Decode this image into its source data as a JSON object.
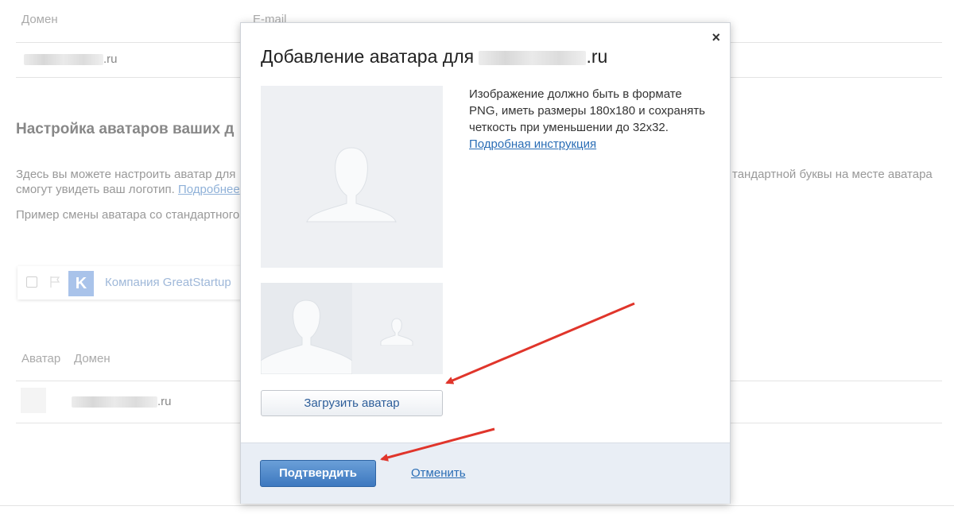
{
  "background": {
    "table1_header_domain": "Домен",
    "table1_header_email": "E-mail",
    "table1_row_domain_suffix": ".ru",
    "section_title": "Настройка аватаров ваших д",
    "description_left": "Здесь вы можете настроить аватар для",
    "description_left_2": "смогут увидеть ваш логотип.",
    "description_link": "Подробнее",
    "description_right": "тандартной буквы на месте аватара",
    "example_text": "Пример смены аватара со стандартного",
    "example_letter": "K",
    "example_company": "Компания GreatStartup",
    "table2_header_avatar": "Аватар",
    "table2_header_domain": "Домен",
    "table2_row_domain_suffix": ".ru"
  },
  "modal": {
    "title_prefix": "Добавление аватара для",
    "title_suffix": ".ru",
    "close_glyph": "×",
    "info_text": "Изображение должно быть в формате PNG, иметь размеры 180x180 и сохранять четкость при уменьшении до 32x32.",
    "info_link": "Подробная инструкция",
    "upload_label": "Загрузить аватар",
    "confirm_label": "Подтвердить",
    "cancel_label": "Отменить"
  },
  "colors": {
    "accent_blue": "#3d78bf",
    "link_blue": "#2a6db5",
    "arrow_red": "#e0352b",
    "footer_bg": "#e9eef5"
  },
  "icons": [
    "close-icon",
    "avatar-placeholder-icon",
    "checkbox-icon",
    "flag-icon",
    "arrow-annotation-icon"
  ]
}
